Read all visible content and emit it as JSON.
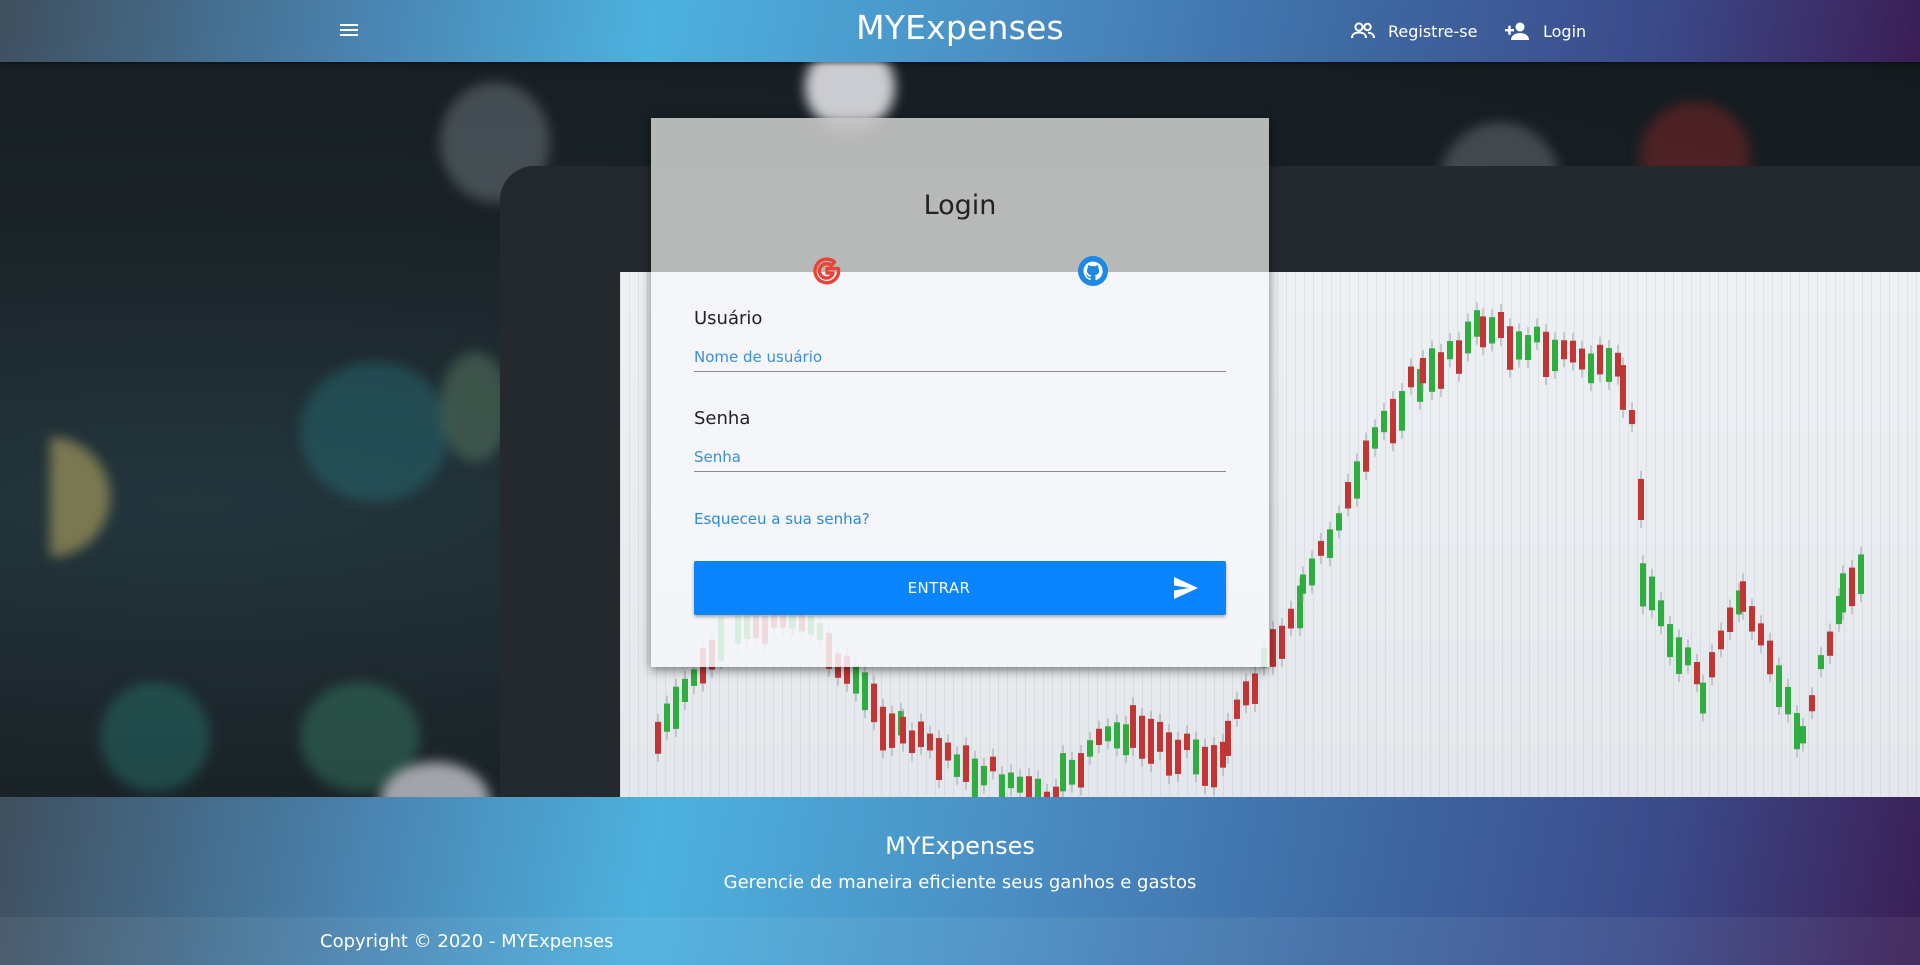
{
  "header": {
    "brand": "MYExpenses",
    "register_label": "Registre-se",
    "login_label": "Login"
  },
  "login_card": {
    "title": "Login",
    "username": {
      "label": "Usuário",
      "placeholder": "Nome de usuário"
    },
    "password": {
      "label": "Senha",
      "placeholder": "Senha"
    },
    "forgot_link": "Esqueceu a sua senha?",
    "submit_label": "ENTRAR",
    "social": [
      "google-icon",
      "github-icon"
    ]
  },
  "footer": {
    "brand": "MYExpenses",
    "tagline": "Gerencie de maneira eficiente seus ganhos e gastos",
    "copyright": "Copyright © 2020 - MYExpenses"
  },
  "colors": {
    "primary_button": "#0a84ff",
    "link": "#2d8ad6",
    "google_red": "#ea4335",
    "github_blue": "#1e88e5"
  }
}
